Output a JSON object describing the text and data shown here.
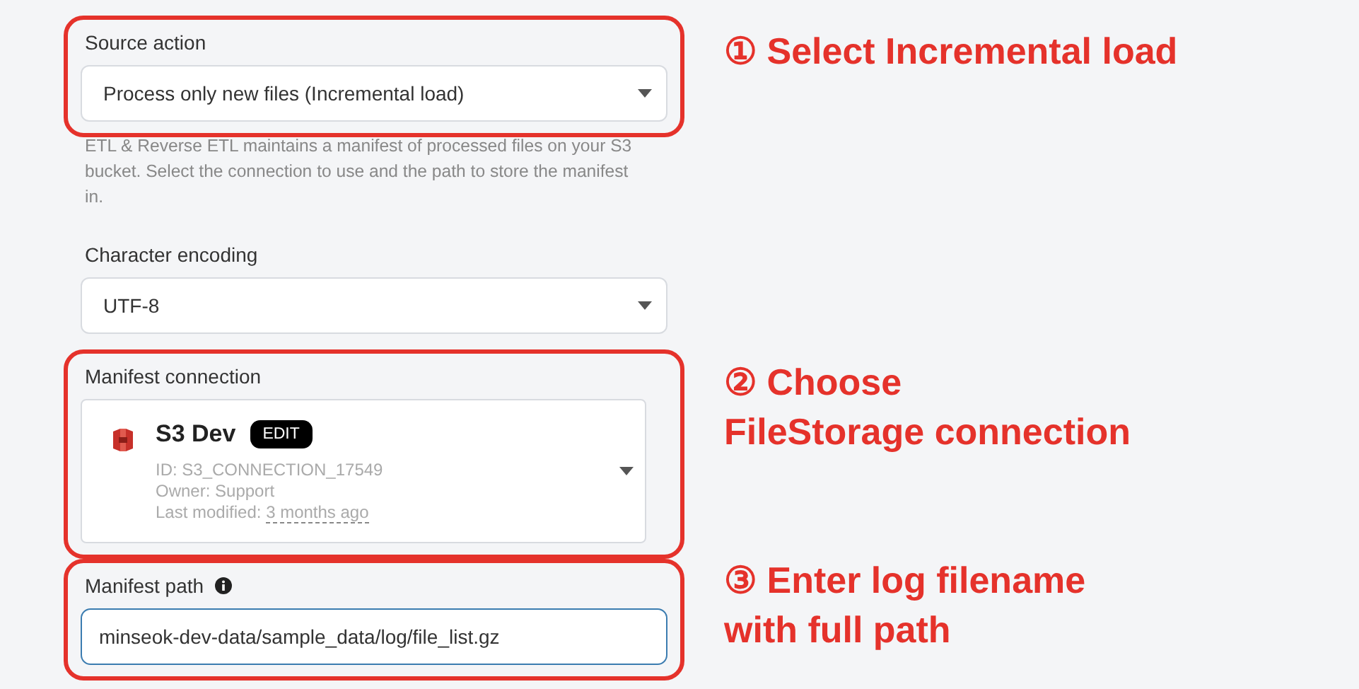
{
  "sections": [
    {
      "kind": "select",
      "label": "Source action",
      "value": "Process only new files (Incremental load)",
      "highlighted": true,
      "callout": {
        "number": "①",
        "lines": [
          "Select Incremental load"
        ]
      }
    },
    {
      "kind": "description",
      "text": "ETL & Reverse ETL maintains a manifest of processed files on your S3 bucket. Select the connection to use and the path to store the manifest in.",
      "highlighted": false
    },
    {
      "kind": "select",
      "label": "Character encoding",
      "value": "UTF-8",
      "highlighted": false
    },
    {
      "kind": "connection",
      "label": "Manifest connection",
      "name": "S3 Dev",
      "edit": "EDIT",
      "id": "ID: S3_CONNECTION_17549",
      "owner": "Owner: Support",
      "modified_label": "Last modified:",
      "modified_value": "3 months ago",
      "highlighted": true,
      "callout": {
        "number": "②",
        "lines": [
          "Choose",
          "FileStorage connection"
        ]
      }
    },
    {
      "kind": "text_input",
      "label": "Manifest path",
      "info": true,
      "value": "minseok-dev-data/sample_data/log/file_list.gz",
      "highlighted": true,
      "callout": {
        "number": "③",
        "lines": [
          "Enter log filename",
          "with full path"
        ]
      }
    }
  ]
}
